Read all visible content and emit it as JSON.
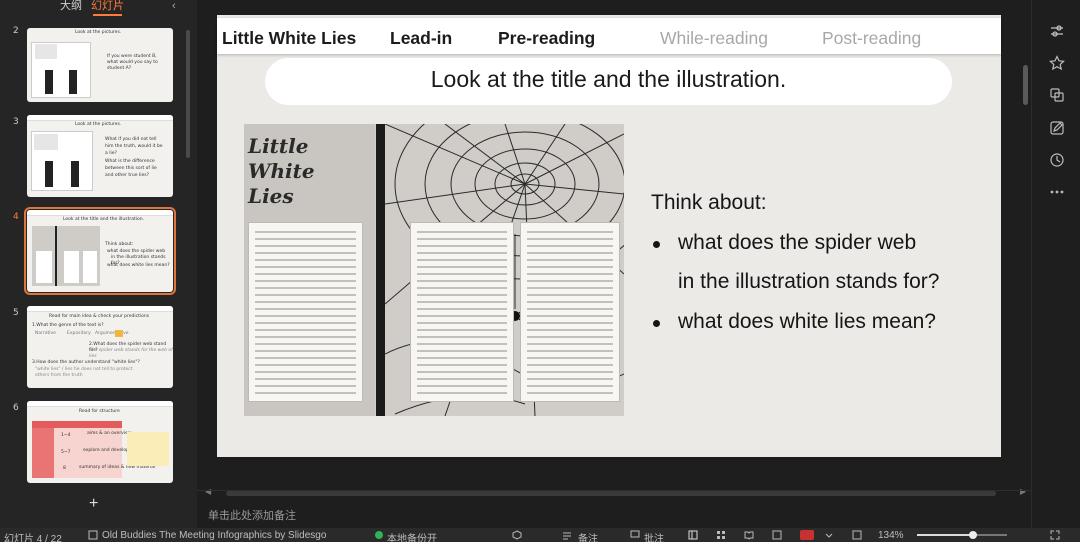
{
  "left_panel": {
    "tabs": {
      "outline": "大纲",
      "slides": "幻灯片"
    },
    "collapse_icon": "‹",
    "thumbnails": [
      {
        "number": "",
        "title": "Look at the pictures.",
        "lines": [
          "If you were student B,",
          "what would you say to",
          "student A?"
        ]
      },
      {
        "number": "3",
        "title": "Look at the pictures.",
        "lines": [
          "What if you did not tell",
          "him the truth, would it be",
          "a lie?",
          "What is the difference",
          "between this sort of lie",
          "and other true lies?"
        ]
      },
      {
        "number": "4",
        "title": "Look at the title and the illustration.",
        "lines": [
          "Think about:",
          "what does the spider web",
          "in the illustration stands for?",
          "what does white lies mean?"
        ]
      },
      {
        "number": "5",
        "title": "Read for main idea & check your predictions",
        "lines": [
          "1.What the genre of the text is?",
          "Narrative",
          "Expository",
          "Argumentative",
          "2.What does the spider web stand for?",
          "The spider web stands for the web of lies",
          "3.How does the author understand \"white lies\"?",
          "\"white lies\" / lies he does not tell to protect",
          "others from the truth"
        ]
      },
      {
        "number": "6",
        "title": "Read for structure",
        "lines": [
          "1~4",
          "aims & an overview",
          "5~7",
          "explore and develop argument",
          "8",
          "summary of ideas & new material"
        ]
      }
    ],
    "add_slide": "+"
  },
  "slide": {
    "nav": {
      "title": "Little White Lies",
      "items": [
        "Lead-in",
        "Pre-reading",
        "While-reading",
        "Post-reading"
      ]
    },
    "heading": "Look at the title and the illustration.",
    "illustration_title": [
      "Little",
      "White",
      "Lies"
    ],
    "think": {
      "head": "Think about:",
      "bullets": [
        [
          "what does the spider web",
          "in the illustration stands for?"
        ],
        [
          "what does white lies mean?"
        ]
      ]
    }
  },
  "notes_placeholder": "单击此处添加备注",
  "status": {
    "slide_counter": "幻灯片 4 / 22",
    "theme": "Old Buddies The Meeting Infographics by Slidesgo",
    "backup": "本地备份开",
    "notes": "备注",
    "comments": "批注",
    "zoom": "134%",
    "zoom_fraction": 0.62
  },
  "colors": {
    "accent": "#ff7a3d",
    "record": "#c73131",
    "backup_dot": "#2fb45a"
  },
  "icons": {
    "right": [
      "settings-sliders-icon",
      "star-icon",
      "copy-icon",
      "edit-icon",
      "history-icon",
      "more-icon"
    ]
  }
}
